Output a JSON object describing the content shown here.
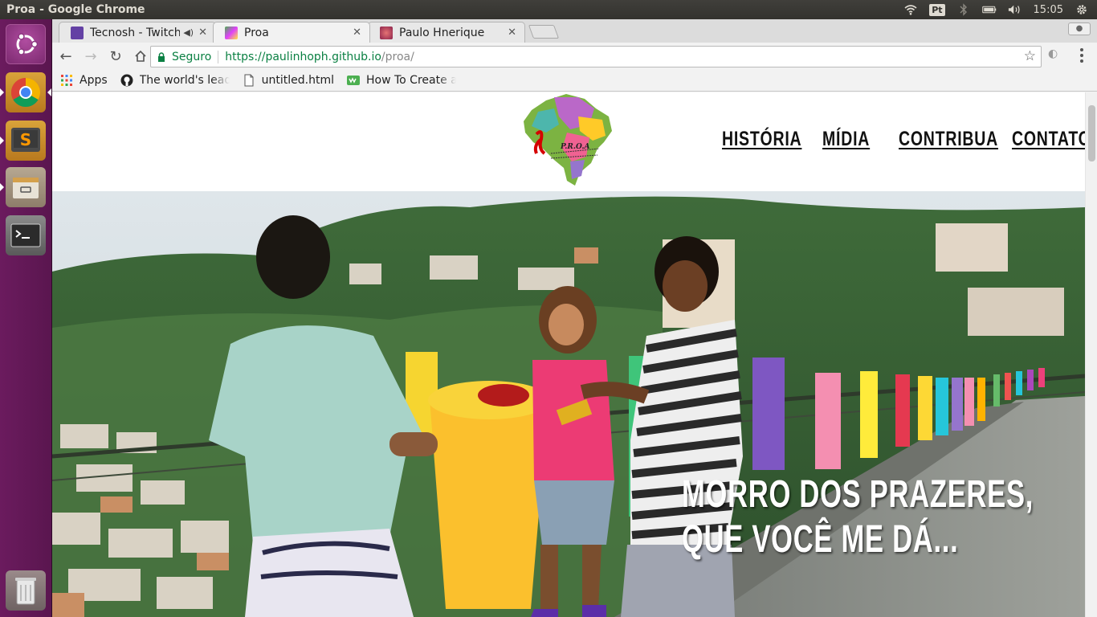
{
  "system": {
    "window_title": "Proa - Google Chrome",
    "keyboard_layout": "Pt",
    "clock": "15:05",
    "tray_icons": [
      "wifi-icon",
      "keyboard-layout-badge",
      "bluetooth-icon",
      "battery-icon",
      "volume-icon",
      "clock",
      "settings-gear-icon"
    ]
  },
  "launcher": {
    "items": [
      "ubuntu-dash-icon",
      "chrome-icon",
      "sublime-text-icon",
      "files-icon",
      "terminal-icon",
      "trash-icon"
    ]
  },
  "browser": {
    "tabs": [
      {
        "label": "Tecnosh - Twitch",
        "favicon": "twitch-icon",
        "audio": true,
        "active": false
      },
      {
        "label": "Proa",
        "favicon": "proa-icon",
        "audio": false,
        "active": true
      },
      {
        "label": "Paulo Hnerique",
        "favicon": "profile-icon",
        "audio": false,
        "active": false
      }
    ],
    "omnibox": {
      "security_label": "Seguro",
      "url_scheme_host": "https://paulinhoph.github.io",
      "url_path": "/proa/"
    },
    "bookmarks": [
      {
        "label": "Apps",
        "icon": "apps-grid-icon"
      },
      {
        "label": "The world's lead",
        "icon": "github-icon"
      },
      {
        "label": "untitled.html",
        "icon": "file-icon"
      },
      {
        "label": "How To Create a",
        "icon": "site-icon"
      }
    ]
  },
  "page": {
    "nav": [
      "HISTÓRIA",
      "MÍDIA",
      "CONTRIBUA",
      "CONTATO"
    ],
    "logo_text": "P.R.O.A",
    "hero_title_line1": "MORRO DOS PRAZERES,",
    "hero_title_line2": "QUE VOCÊ ME DÁ..."
  },
  "colors": {
    "launcher": "#6b1b5e",
    "secure_green": "#0b8043",
    "nav_text": "#111111",
    "hero_text": "#ffffff"
  }
}
